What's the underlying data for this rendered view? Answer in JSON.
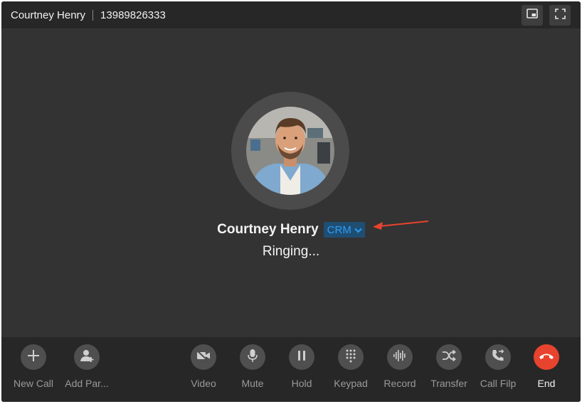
{
  "titlebar": {
    "contact_name": "Courtney Henry",
    "phone_number": "13989826333",
    "pip_icon": "picture-in-picture-icon",
    "fullscreen_icon": "fullscreen-icon"
  },
  "call": {
    "caller_name": "Courtney Henry",
    "crm_label": "CRM",
    "status": "Ringing..."
  },
  "toolbar": {
    "buttons": [
      {
        "label": "New Call",
        "icon": "plus-icon"
      },
      {
        "label": "Add Par...",
        "icon": "add-participant-icon"
      },
      {
        "label": "Video",
        "icon": "video-off-icon"
      },
      {
        "label": "Mute",
        "icon": "microphone-icon"
      },
      {
        "label": "Hold",
        "icon": "pause-icon"
      },
      {
        "label": "Keypad",
        "icon": "keypad-icon"
      },
      {
        "label": "Record",
        "icon": "waveform-icon"
      },
      {
        "label": "Transfer",
        "icon": "shuffle-icon"
      },
      {
        "label": "Call Filp",
        "icon": "phone-flip-icon"
      },
      {
        "label": "End",
        "icon": "hang-up-icon"
      }
    ]
  },
  "colors": {
    "window_bg": "#333333",
    "bar_bg": "#272727",
    "tool_circle": "#4f4f4f",
    "end_red": "#e8432e",
    "crm_blue": "#2e9cf3",
    "annotation_red": "#e8432e"
  }
}
